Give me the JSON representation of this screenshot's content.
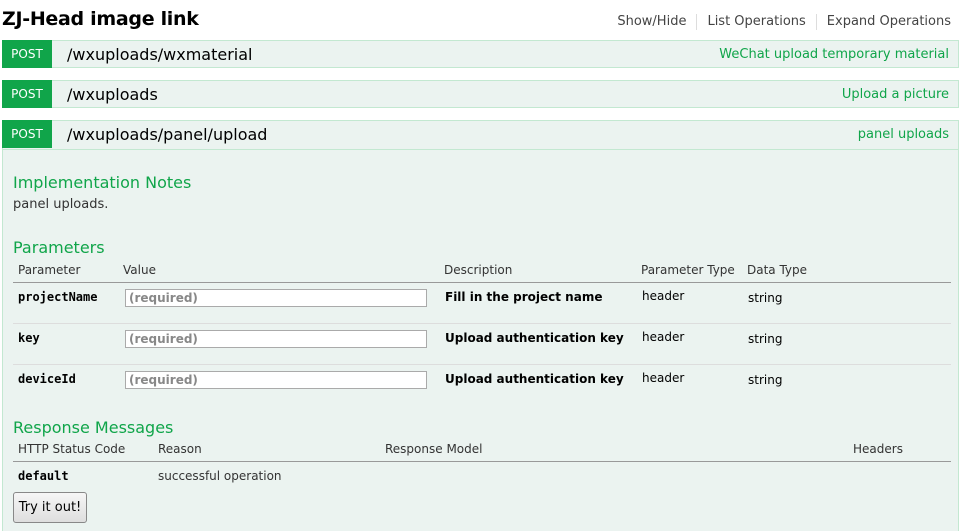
{
  "header": {
    "title": "ZJ-Head image link",
    "links": [
      "Show/Hide",
      "List Operations",
      "Expand Operations"
    ]
  },
  "operations": [
    {
      "method": "POST",
      "path": "/wxuploads/wxmaterial",
      "summary": "WeChat upload temporary material"
    },
    {
      "method": "POST",
      "path": "/wxuploads",
      "summary": "Upload a picture"
    },
    {
      "method": "POST",
      "path": "/wxuploads/panel/upload",
      "summary": "panel uploads"
    }
  ],
  "details": {
    "notes_title": "Implementation Notes",
    "notes_text": "panel uploads.",
    "params_title": "Parameters",
    "params_columns": [
      "Parameter",
      "Value",
      "Description",
      "Parameter Type",
      "Data Type"
    ],
    "params": [
      {
        "name": "projectName",
        "placeholder": "(required)",
        "description": "Fill in the project name",
        "param_type": "header",
        "data_type": "string"
      },
      {
        "name": "key",
        "placeholder": "(required)",
        "description": "Upload authentication key",
        "param_type": "header",
        "data_type": "string"
      },
      {
        "name": "deviceId",
        "placeholder": "(required)",
        "description": "Upload authentication key",
        "param_type": "header",
        "data_type": "string"
      }
    ],
    "responses_title": "Response Messages",
    "responses_columns": [
      "HTTP Status Code",
      "Reason",
      "Response Model",
      "Headers"
    ],
    "responses": [
      {
        "code": "default",
        "reason": "successful operation"
      }
    ],
    "try_button": "Try it out!"
  },
  "colors": {
    "accent": "#10a54a",
    "row_bg": "#ebf3f0",
    "border": "#c3e8d1"
  }
}
